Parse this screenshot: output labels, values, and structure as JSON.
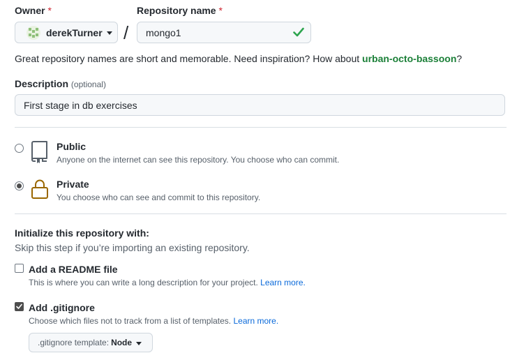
{
  "owner": {
    "label": "Owner",
    "required_mark": "*",
    "selected": "derekTurner"
  },
  "separator": "/",
  "repo_name": {
    "label": "Repository name",
    "required_mark": "*",
    "value": "mongo1",
    "valid": true
  },
  "hint": {
    "text": "Great repository names are short and memorable. Need inspiration? How about ",
    "suggestion": "urban-octo-bassoon",
    "end": "?"
  },
  "description": {
    "label": "Description",
    "optional": "(optional)",
    "value": "First stage in db exercises"
  },
  "visibility": {
    "public": {
      "title": "Public",
      "subtitle": "Anyone on the internet can see this repository. You choose who can commit.",
      "icon": "repo-icon",
      "checked": false
    },
    "private": {
      "title": "Private",
      "subtitle": "You choose who can see and commit to this repository.",
      "icon": "lock-icon",
      "checked": true
    }
  },
  "initialize": {
    "title": "Initialize this repository with:",
    "subtitle": "Skip this step if you’re importing an existing repository.",
    "readme": {
      "label": "Add a README file",
      "description": "This is where you can write a long description for your project. ",
      "link": "Learn more.",
      "checked": false
    },
    "gitignore": {
      "label": "Add .gitignore",
      "description": "Choose which files not to track from a list of templates. ",
      "link": "Learn more.",
      "checked": true
    },
    "template": {
      "label": ".gitignore template:",
      "value": "Node"
    }
  },
  "colors": {
    "accent_link": "#0969da",
    "success": "#1a7f37",
    "required": "#cf222e",
    "lock_icon": "#9a6700"
  }
}
